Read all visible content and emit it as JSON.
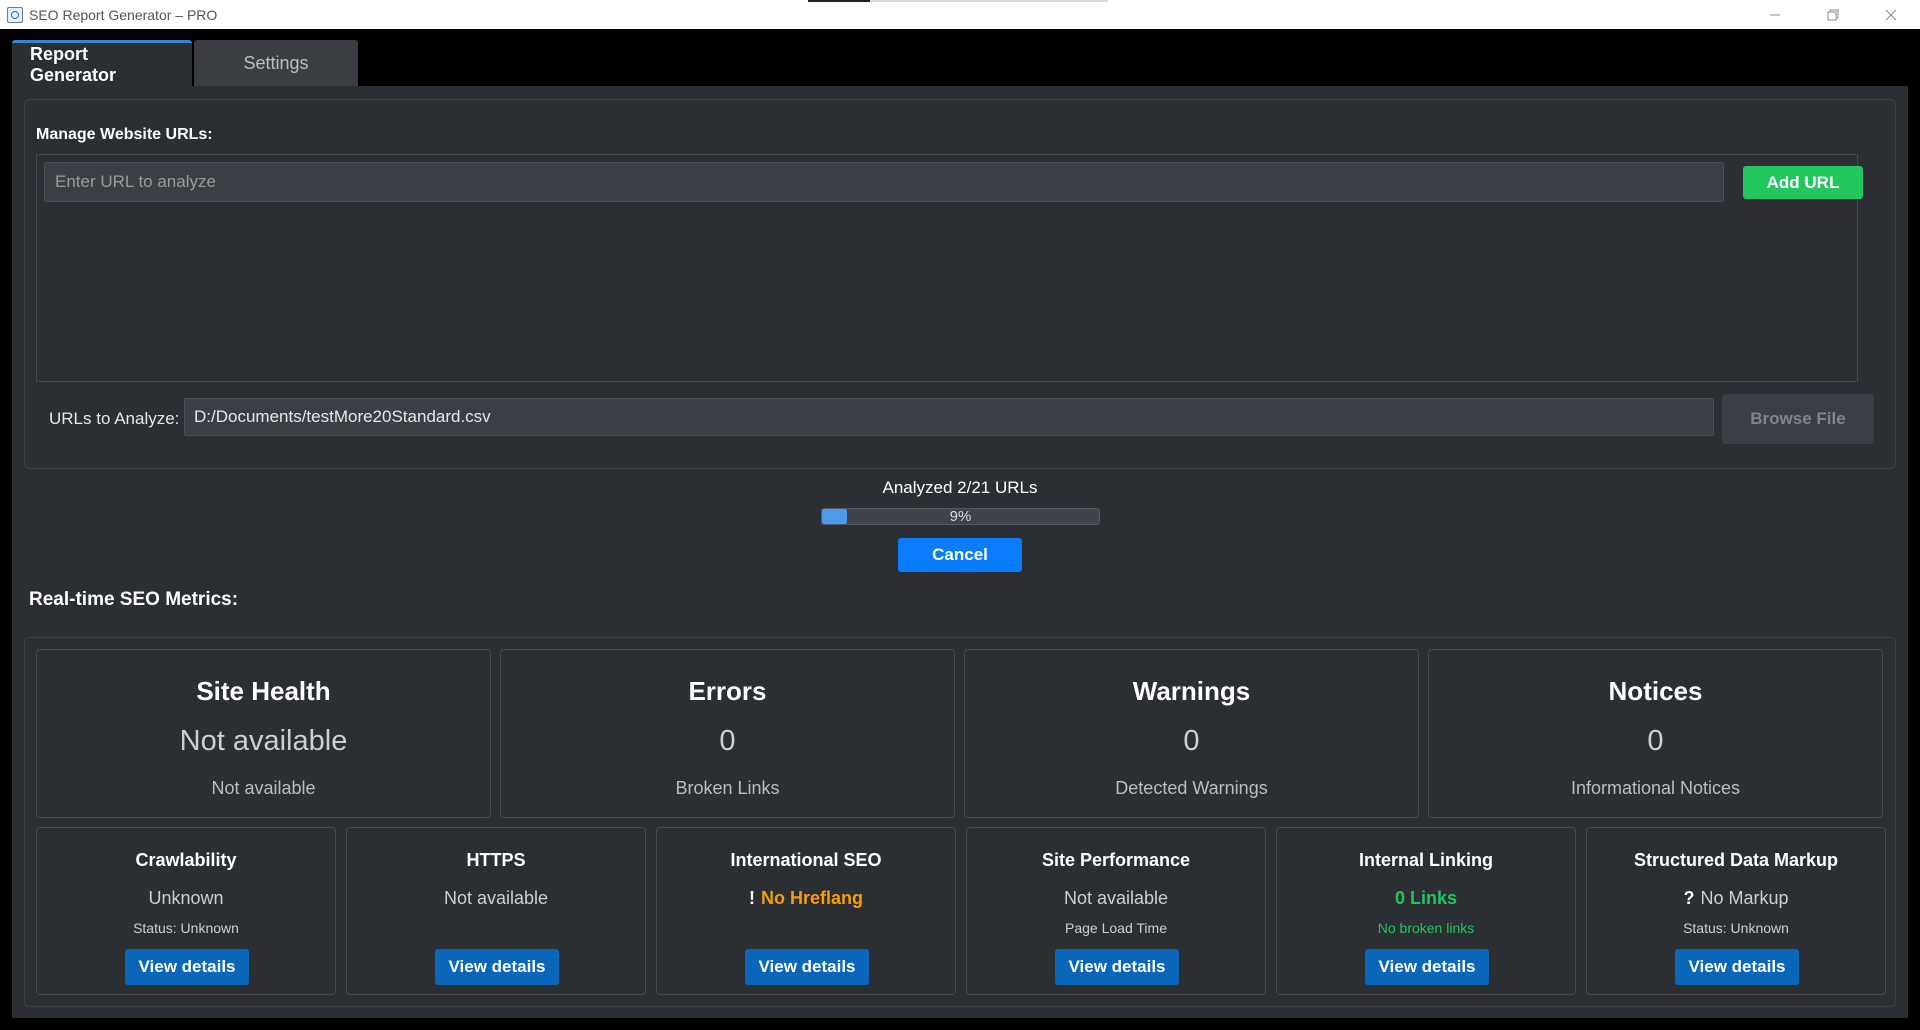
{
  "window": {
    "title": "SEO Report Generator – PRO",
    "controls": {
      "minimize": "—",
      "restore": "❐",
      "close": "✕"
    }
  },
  "tabs": [
    {
      "label": "Report Generator",
      "active": true
    },
    {
      "label": "Settings",
      "active": false
    }
  ],
  "urls": {
    "section_label": "Manage Website URLs:",
    "input_placeholder": "Enter URL to analyze",
    "add_button": "Add URL",
    "file_label": "URLs to Analyze:",
    "file_path": "D:/Documents/testMore20Standard.csv",
    "browse_button": "Browse File"
  },
  "progress": {
    "status": "Analyzed 2/21 URLs",
    "percent_label": "9%",
    "fraction": 0.09,
    "cancel_button": "Cancel"
  },
  "metrics": {
    "title": "Real-time SEO Metrics:",
    "summary": [
      {
        "title": "Site Health",
        "value": "Not available",
        "sub": "Not available"
      },
      {
        "title": "Errors",
        "value": "0",
        "sub": "Broken Links"
      },
      {
        "title": "Warnings",
        "value": "0",
        "sub": "Detected Warnings"
      },
      {
        "title": "Notices",
        "value": "0",
        "sub": "Informational Notices"
      }
    ],
    "cards": [
      {
        "title": "Crawlability",
        "value": "Unknown",
        "sub": "Status: Unknown",
        "button": "View details"
      },
      {
        "title": "HTTPS",
        "value": "Not available",
        "sub": "",
        "button": "View details"
      },
      {
        "title": "International SEO",
        "glyph": "!",
        "value": "No Hreflang",
        "sub": "",
        "button": "View details"
      },
      {
        "title": "Site Performance",
        "value": "Not available",
        "sub": "Page Load Time",
        "button": "View details"
      },
      {
        "title": "Internal Linking",
        "value": "0 Links",
        "sub": "No broken links",
        "button": "View details"
      },
      {
        "title": "Structured Data Markup",
        "glyph": "?",
        "value": "No Markup",
        "sub": "Status: Unknown",
        "button": "View details"
      }
    ]
  },
  "colors": {
    "accent_green": "#22c55e",
    "accent_blue": "#0a7cff",
    "detail_button": "#0a66b8",
    "warning": "#f59e0b",
    "progress_fill": "#4c9be8",
    "background": "#2b2e32"
  }
}
